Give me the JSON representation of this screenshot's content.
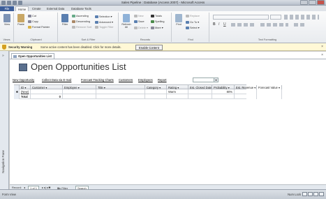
{
  "window": {
    "title": "Sales Pipeline : Database (Access 2007) - Microsoft Access"
  },
  "tabs": [
    "File",
    "Home",
    "Create",
    "External Data",
    "Database Tools"
  ],
  "ribbon": {
    "views": {
      "label": "View",
      "group": "Views"
    },
    "clipboard": {
      "paste": "Paste",
      "cut": "Cut",
      "copy": "Copy",
      "format_painter": "Format Painter",
      "group": "Clipboard"
    },
    "sort": {
      "filter": "Filter",
      "ascending": "Ascending",
      "descending": "Descending",
      "remove_sort": "Remove Sort",
      "selection": "Selection",
      "advanced": "Advanced",
      "toggle_filter": "Toggle Filter",
      "group": "Sort & Filter"
    },
    "records": {
      "refresh": "Refresh All",
      "new": "New",
      "save": "Save",
      "delete": "Delete",
      "totals": "Totals",
      "spelling": "Spelling",
      "more": "More",
      "group": "Records"
    },
    "find": {
      "find": "Find",
      "replace": "Replace",
      "goto": "Go To",
      "select": "Select",
      "group": "Find"
    },
    "text": {
      "group": "Text Formatting"
    }
  },
  "warning": {
    "title": "Security Warning",
    "message": "Some active content has been disabled. Click for more details.",
    "button": "Enable Content"
  },
  "nav_pane": {
    "label": "Navigation Pane"
  },
  "document": {
    "tab": "Open Opportunities List",
    "form_title": "Open Opportunities List"
  },
  "links": [
    "New Opportunity",
    "Collect Data via E-mail",
    "Forecast Tracking Charts",
    "Customers",
    "Employees",
    "Report"
  ],
  "grid": {
    "columns": [
      "ID",
      "Customer",
      "Employee",
      "Title",
      "Category",
      "Rating",
      "Est. Closed Date",
      "Probability",
      "Est. Revenue",
      "Forecast Value"
    ],
    "new_row": {
      "id": "(New)",
      "rating": "Warm",
      "probability": "80%"
    },
    "total_row": {
      "label": "Total",
      "value": "0"
    }
  },
  "record_nav": {
    "record": "Record:",
    "position": "1 of 1",
    "filter": "No Filter",
    "search": "Search"
  },
  "status": {
    "left": "Form View",
    "num_lock": "Num Lock"
  }
}
